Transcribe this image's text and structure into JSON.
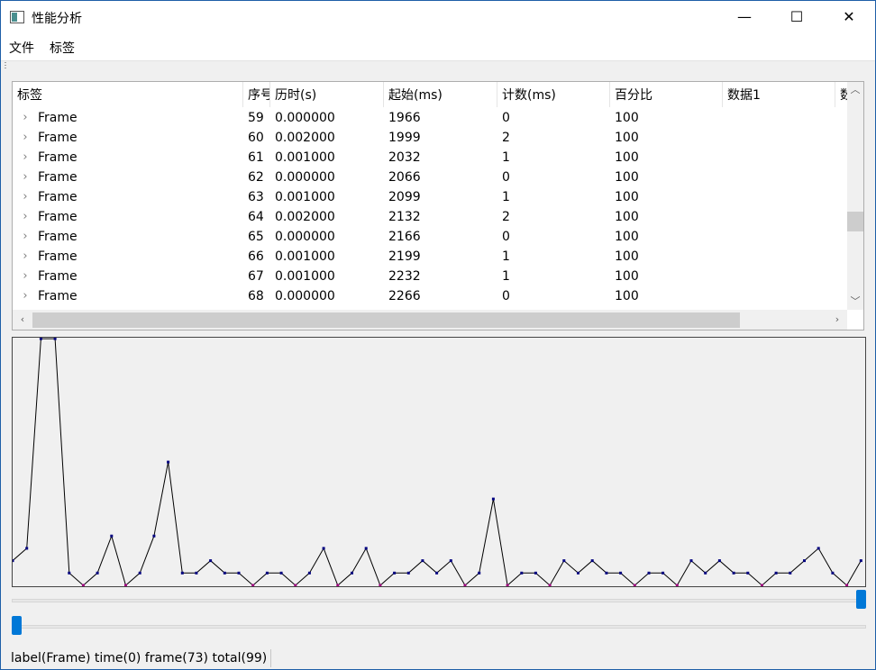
{
  "window": {
    "title": "性能分析",
    "controls": {
      "minimize": "—",
      "maximize": "☐",
      "close": "✕"
    }
  },
  "menu": [
    "文件",
    "标签"
  ],
  "table": {
    "columns": [
      "标签",
      "序号",
      "历时(s)",
      "起始(ms)",
      "计数(ms)",
      "百分比",
      "数据1",
      "数"
    ],
    "rows": [
      [
        "Frame",
        "59",
        "0.000000",
        "1966",
        "0",
        "100"
      ],
      [
        "Frame",
        "60",
        "0.002000",
        "1999",
        "2",
        "100"
      ],
      [
        "Frame",
        "61",
        "0.001000",
        "2032",
        "1",
        "100"
      ],
      [
        "Frame",
        "62",
        "0.000000",
        "2066",
        "0",
        "100"
      ],
      [
        "Frame",
        "63",
        "0.001000",
        "2099",
        "1",
        "100"
      ],
      [
        "Frame",
        "64",
        "0.002000",
        "2132",
        "2",
        "100"
      ],
      [
        "Frame",
        "65",
        "0.000000",
        "2166",
        "0",
        "100"
      ],
      [
        "Frame",
        "66",
        "0.001000",
        "2199",
        "1",
        "100"
      ],
      [
        "Frame",
        "67",
        "0.001000",
        "2232",
        "1",
        "100"
      ],
      [
        "Frame",
        "68",
        "0.000000",
        "2266",
        "0",
        "100"
      ]
    ],
    "row_icon": "chevron-right-icon"
  },
  "chart_data": {
    "type": "line",
    "values": [
      2,
      3,
      20,
      20,
      1,
      0,
      1,
      4,
      0,
      1,
      4,
      10,
      1,
      1,
      2,
      1,
      1,
      0,
      1,
      1,
      0,
      1,
      3,
      0,
      1,
      3,
      0,
      1,
      1,
      2,
      1,
      2,
      0,
      1,
      7,
      0,
      1,
      1,
      0,
      2,
      1,
      2,
      1,
      1,
      0,
      1,
      1,
      0,
      2,
      1,
      2,
      1,
      1,
      0,
      1,
      1,
      2,
      3,
      1,
      0,
      2
    ],
    "ylim": [
      0,
      20
    ],
    "line_color": "#000000",
    "point_color": "#00007f",
    "zero_point_color": "#a0007f",
    "grid": false
  },
  "sliders": {
    "top_level": 1.0,
    "bottom_level": 0.0,
    "handle_color": "#0078d7"
  },
  "status": "label(Frame) time(0) frame(73) total(99)"
}
